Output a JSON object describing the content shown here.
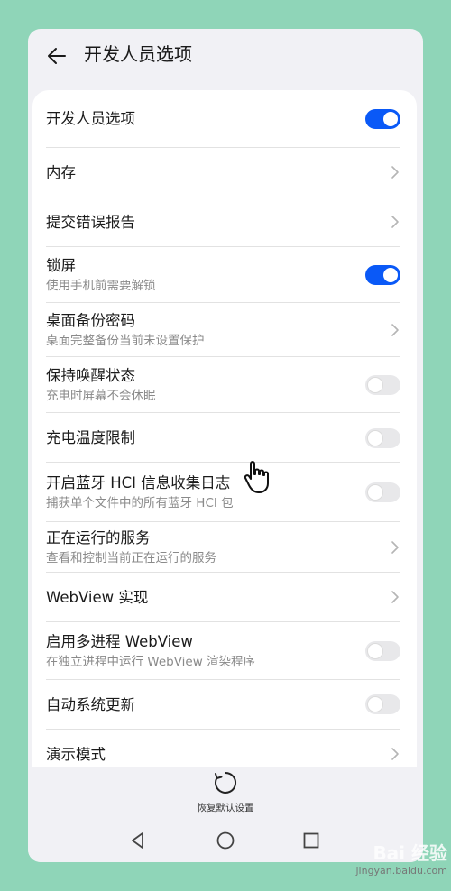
{
  "header": {
    "title": "开发人员选项"
  },
  "rows": [
    {
      "title": "开发人员选项",
      "subtitle": "",
      "control": "toggle",
      "state": true
    },
    {
      "title": "内存",
      "subtitle": "",
      "control": "chevron"
    },
    {
      "title": "提交错误报告",
      "subtitle": "",
      "control": "chevron"
    },
    {
      "title": "锁屏",
      "subtitle": "使用手机前需要解锁",
      "control": "toggle",
      "state": true
    },
    {
      "title": "桌面备份密码",
      "subtitle": "桌面完整备份当前未设置保护",
      "control": "chevron"
    },
    {
      "title": "保持唤醒状态",
      "subtitle": "充电时屏幕不会休眠",
      "control": "toggle",
      "state": false
    },
    {
      "title": "充电温度限制",
      "subtitle": "",
      "control": "toggle",
      "state": false
    },
    {
      "title": "开启蓝牙 HCI 信息收集日志",
      "subtitle": "捕获单个文件中的所有蓝牙 HCI 包",
      "control": "toggle",
      "state": false
    },
    {
      "title": "正在运行的服务",
      "subtitle": "查看和控制当前正在运行的服务",
      "control": "chevron"
    },
    {
      "title": "WebView 实现",
      "subtitle": "",
      "control": "chevron"
    },
    {
      "title": "启用多进程 WebView",
      "subtitle": "在独立进程中运行 WebView 渲染程序",
      "control": "toggle",
      "state": false
    },
    {
      "title": "自动系统更新",
      "subtitle": "",
      "control": "toggle",
      "state": false
    },
    {
      "title": "演示模式",
      "subtitle": "",
      "control": "chevron"
    }
  ],
  "bottom": {
    "restore_label": "恢复默认设置"
  },
  "watermark": {
    "brand": "Bai 经验",
    "url": "jingyan.baidu.com"
  },
  "colors": {
    "accent": "#0a59f7",
    "background": "#8fd5b8"
  }
}
